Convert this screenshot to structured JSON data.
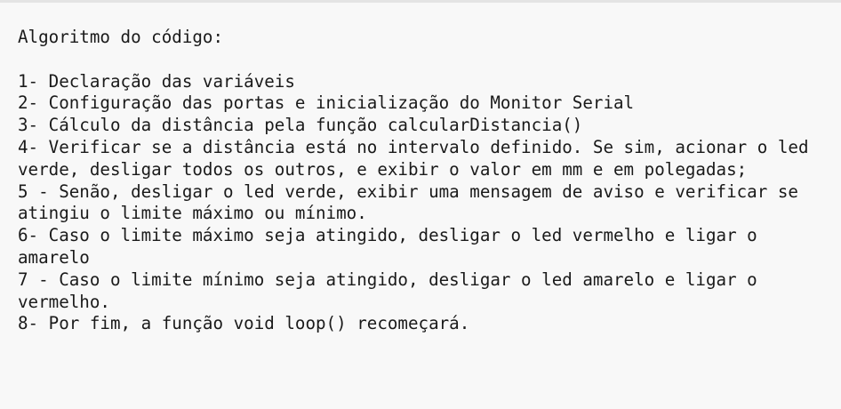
{
  "document": {
    "lines": [
      "Algoritmo do código:",
      "",
      "1- Declaração das variáveis",
      "2- Configuração das portas e inicialização do Monitor Serial",
      "3- Cálculo da distância pela função calcularDistancia()",
      "4- Verificar se a distância está no intervalo definido. Se sim, acionar o led",
      "verde, desligar todos os outros, e exibir o valor em mm e em polegadas;",
      "5 - Senão, desligar o led verde, exibir uma mensagem de aviso e verificar se",
      "atingiu o limite máximo ou mínimo.",
      "6- Caso o limite máximo seja atingido, desligar o led vermelho e ligar o",
      "amarelo",
      "7 - Caso o limite mínimo seja atingido, desligar o led amarelo e ligar o",
      "vermelho.",
      "8- Por fim, a função void loop() recomeçará."
    ]
  }
}
